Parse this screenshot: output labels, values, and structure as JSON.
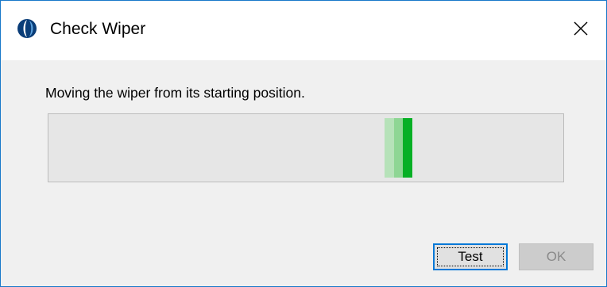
{
  "window": {
    "title": "Check Wiper",
    "app_icon": "app-logo-icon",
    "close_icon": "close-icon"
  },
  "content": {
    "message": "Moving the wiper from its starting position.",
    "progress": {
      "style": "marquee",
      "colors": {
        "track": "#e6e6e6",
        "border": "#bcbcbc",
        "chunk_light": "#b6e2b9",
        "chunk_mid": "#8ed694",
        "chunk_dark": "#06b025"
      }
    }
  },
  "buttons": {
    "test_label": "Test",
    "ok_label": "OK",
    "ok_enabled": false
  },
  "colors": {
    "accent": "#0078d7",
    "window_border": "#1979ca"
  }
}
